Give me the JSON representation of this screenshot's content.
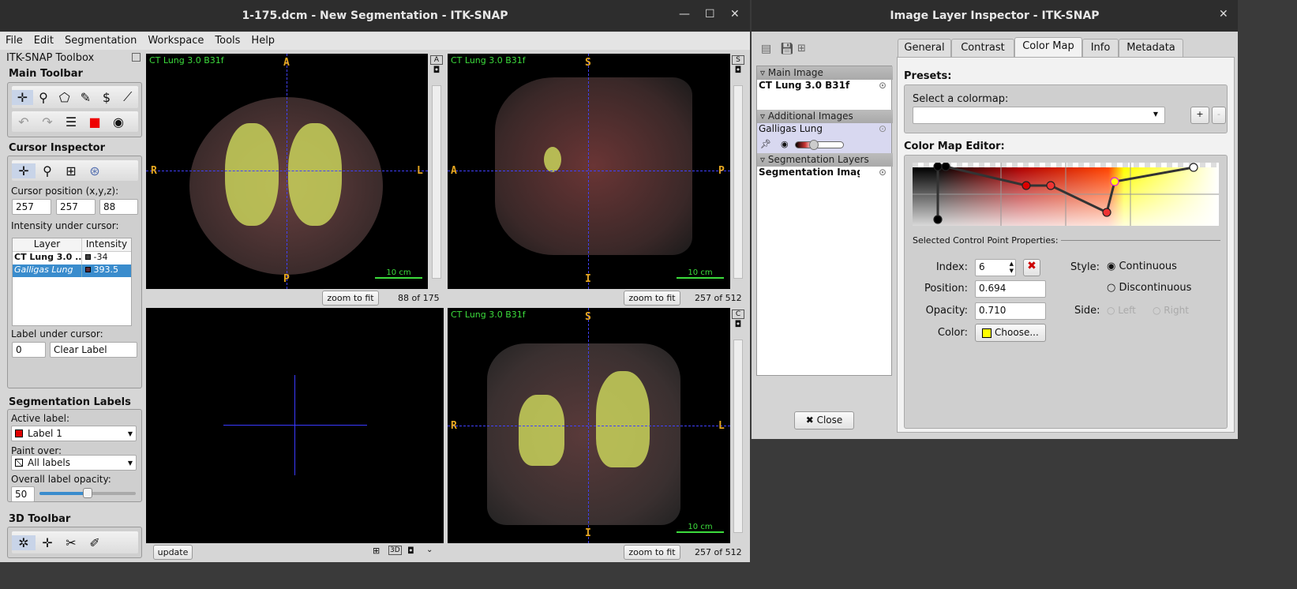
{
  "main_window": {
    "title": "1-175.dcm - New Segmentation - ITK-SNAP",
    "menu": [
      "File",
      "Edit",
      "Segmentation",
      "Workspace",
      "Tools",
      "Help"
    ]
  },
  "toolbox": {
    "title": "ITK-SNAP Toolbox",
    "main_toolbar": "Main Toolbar",
    "cursor_inspector": "Cursor Inspector",
    "cursor_position_label": "Cursor position (x,y,z):",
    "cursor_position": [
      "257",
      "257",
      "88"
    ],
    "intensity_label": "Intensity under cursor:",
    "table_headers": [
      "Layer",
      "Intensity"
    ],
    "rows": [
      {
        "layer": "CT Lung  3.0 ...",
        "intensity": "-34",
        "swatch": "#404040"
      },
      {
        "layer": "Galligas Lung",
        "intensity": "393.5",
        "swatch": "#5a2a36"
      }
    ],
    "label_under_cursor": "Label under cursor:",
    "label_id": "0",
    "label_name": "Clear Label",
    "seg_labels": "Segmentation Labels",
    "active_label_caption": "Active label:",
    "active_label": "Label 1",
    "active_label_color": "#e00000",
    "paint_over_caption": "Paint over:",
    "paint_over": "All labels",
    "opacity_caption": "Overall label opacity:",
    "opacity": "50",
    "opacity_fraction": 0.5,
    "toolbar3d": "3D Toolbar"
  },
  "views": {
    "image_label": "CT Lung  3.0  B31f",
    "scale": "10 cm",
    "axial": {
      "top": "A",
      "bottom": "P",
      "left": "R",
      "right": "L",
      "slice": "88 of 175",
      "button": "zoom to fit",
      "side_tag": "A"
    },
    "sagittal": {
      "top": "S",
      "bottom": "I",
      "left": "A",
      "right": "P",
      "slice": "257 of 512",
      "button": "zoom to fit",
      "side_tag": "S"
    },
    "coronal": {
      "top": "S",
      "bottom": "I",
      "left": "R",
      "right": "L",
      "slice": "257 of 512",
      "button": "zoom to fit",
      "side_tag": "C"
    },
    "three_d": {
      "button": "update"
    }
  },
  "inspector": {
    "title": "Image Layer Inspector - ITK-SNAP",
    "groups": {
      "main": "Main Image",
      "additional": "Additional Images",
      "seg": "Segmentation Layers"
    },
    "layers": {
      "main": "CT Lung  3.0  B31f",
      "additional": "Galligas Lung",
      "seg": "Segmentation Image"
    },
    "close": "Close",
    "tabs": [
      "General",
      "Contrast",
      "Color Map",
      "Info",
      "Metadata"
    ],
    "active_tab": "Color Map",
    "presets": "Presets:",
    "select_colormap": "Select a colormap:",
    "selected_colormap": "",
    "add": "+",
    "remove": "-",
    "editor": "Color Map Editor:",
    "cp_props": "Selected Control Point Properties:",
    "index_label": "Index:",
    "index": "6",
    "position_label": "Position:",
    "position": "0.694",
    "opacity_label": "Opacity:",
    "opacity": "0.710",
    "color_label": "Color:",
    "choose": "Choose...",
    "color": "#ffff00",
    "style_label": "Style:",
    "continuous": "Continuous",
    "discontinuous": "Discontinuous",
    "side_label": "Side:",
    "left": "Left",
    "right": "Right"
  }
}
